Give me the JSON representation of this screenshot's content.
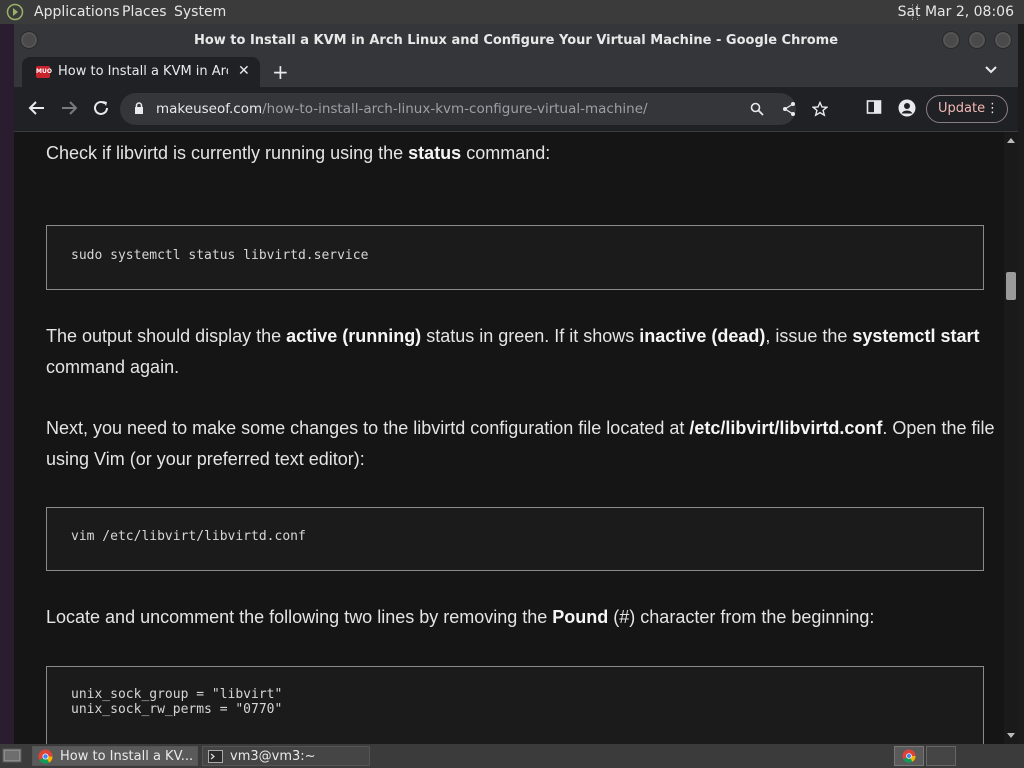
{
  "top_panel": {
    "menus": [
      "Applications",
      "Places",
      "System"
    ],
    "clock": "Sat Mar  2, 08:06"
  },
  "window": {
    "title": "How to Install a KVM in Arch Linux and Configure Your Virtual Machine - Google Chrome"
  },
  "tab": {
    "label": "How to Install a KVM in Arch L",
    "favicon": "MUO",
    "close": "✕"
  },
  "toolbar": {
    "url_domain": "makeuseof.com",
    "url_path": "/how-to-install-arch-linux-kvm-configure-virtual-machine/",
    "update_label": "Update"
  },
  "article": {
    "p1": {
      "pre": "Check if libvirtd is currently running using the ",
      "bold": "status",
      "post": " command:"
    },
    "code1": "sudo systemctl status libvirtd.service",
    "p2": {
      "t1": "The output should display the ",
      "b1": "active (running)",
      "t2": " status in green. If it shows ",
      "b2": "inactive (dead)",
      "t3": ", issue the ",
      "b3": "systemctl start",
      "t4": " command again."
    },
    "p3": {
      "t1": "Next, you need to make some changes to the libvirtd configuration file located at ",
      "b1": "/etc/libvirt/libvirtd.conf",
      "t2": ". Open the file using Vim (or your preferred text editor):"
    },
    "code2": "vim /etc/libvirt/libvirtd.conf",
    "p4": {
      "t1": "Locate and uncomment the following two lines by removing the ",
      "b1": "Pound",
      "t2": " (#) character from the beginning:"
    },
    "code3_line1": "unix_sock_group = \"libvirt\"",
    "code3_line2": "unix_sock_rw_perms = \"0770\""
  },
  "taskbar": {
    "items": [
      "How to Install a KV...",
      "vm3@vm3:~"
    ]
  }
}
